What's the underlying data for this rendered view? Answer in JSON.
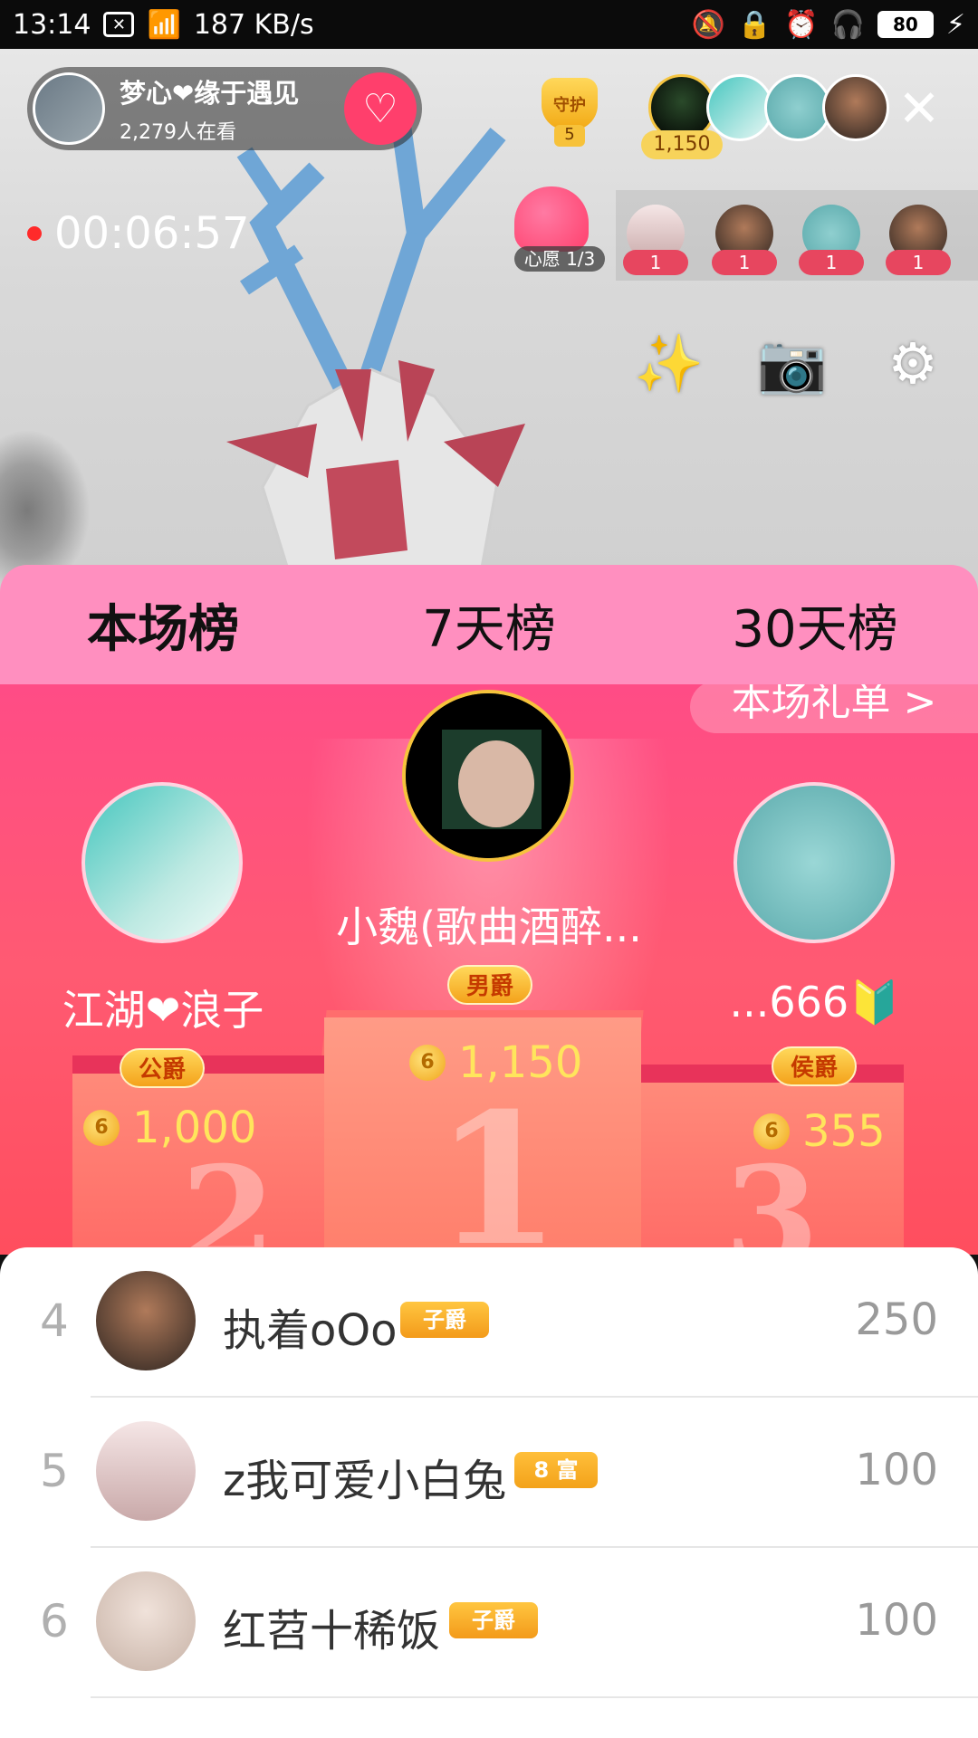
{
  "status_bar": {
    "time": "13:14",
    "speed": "187 KB/s",
    "battery": "80"
  },
  "live_header": {
    "host_name": "梦心❤缘于遇见",
    "viewers": "2,279人在看",
    "guard_label": "守护",
    "guard_count": "5",
    "top_contrib_value": "1,150",
    "timer": "00:06:57",
    "wish_label": "心愿 1/3",
    "fan_counts": [
      "1",
      "1",
      "1",
      "1"
    ]
  },
  "tabs": [
    {
      "label": "本场榜",
      "active": true
    },
    {
      "label": "7天榜",
      "active": false
    },
    {
      "label": "30天榜",
      "active": false
    }
  ],
  "gift_list_link": "本场礼单 >",
  "podium": {
    "first": {
      "name": "小魏(歌曲酒醉...",
      "badge": "男爵",
      "value": "1,150",
      "place": "1"
    },
    "second": {
      "name": "江湖❤浪子",
      "badge": "公爵",
      "value": "1,000",
      "place": "2"
    },
    "third": {
      "name": "...666🔰",
      "badge": "侯爵",
      "value": "355",
      "place": "3"
    }
  },
  "list": [
    {
      "rank": "4",
      "name": "执着oOo",
      "badge": "子爵",
      "value": "250"
    },
    {
      "rank": "5",
      "name": "z我可爱小白兔",
      "badge": "8 富",
      "value": "100"
    },
    {
      "rank": "6",
      "name": "红苕十稀饭",
      "badge": "子爵",
      "value": "100"
    }
  ],
  "colors": {
    "accent_pink": "#ff8fbf",
    "podium_red": "#ff4c86",
    "coin_yellow": "#ffe55c",
    "follow_pink": "#ff3f6c"
  }
}
